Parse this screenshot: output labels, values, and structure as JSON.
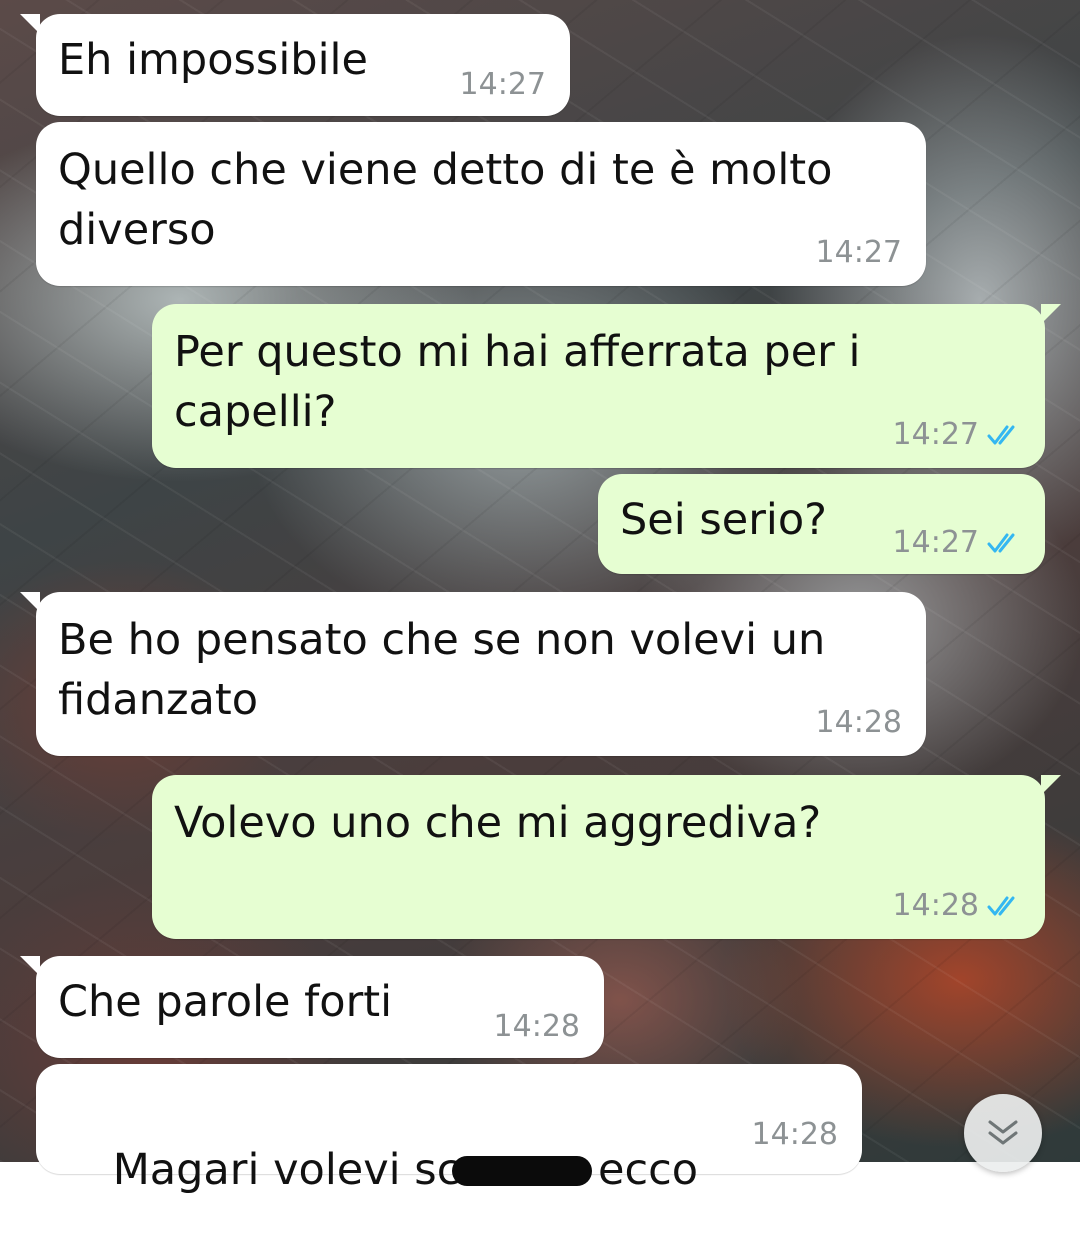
{
  "messages": [
    {
      "direction": "incoming",
      "text": "Eh impossibile",
      "time": "14:27"
    },
    {
      "direction": "incoming",
      "text": "Quello che viene detto di te è molto\ndiverso",
      "time": "14:27"
    },
    {
      "direction": "outgoing",
      "text": "Per questo mi hai afferrata per i\ncapelli?",
      "time": "14:27",
      "status": "read"
    },
    {
      "direction": "outgoing",
      "text": "Sei serio?",
      "time": "14:27",
      "status": "read"
    },
    {
      "direction": "incoming",
      "text": "Be ho pensato che se non volevi un\nfidanzato",
      "time": "14:28"
    },
    {
      "direction": "outgoing",
      "text": "Volevo uno che mi aggrediva?",
      "time": "14:28",
      "status": "read"
    },
    {
      "direction": "incoming",
      "text": "Che parole forti",
      "time": "14:28"
    },
    {
      "direction": "incoming",
      "text_before": "Magari volevi sc",
      "text_after": "ecco",
      "time": "14:28",
      "redacted": true
    }
  ],
  "scroll_button": {
    "icon": "double-chevron-down-icon"
  },
  "colors": {
    "incoming_bubble": "#ffffff",
    "outgoing_bubble": "#e6fed2",
    "timestamp": "#8d9294",
    "read_ticks": "#34b7f1"
  }
}
